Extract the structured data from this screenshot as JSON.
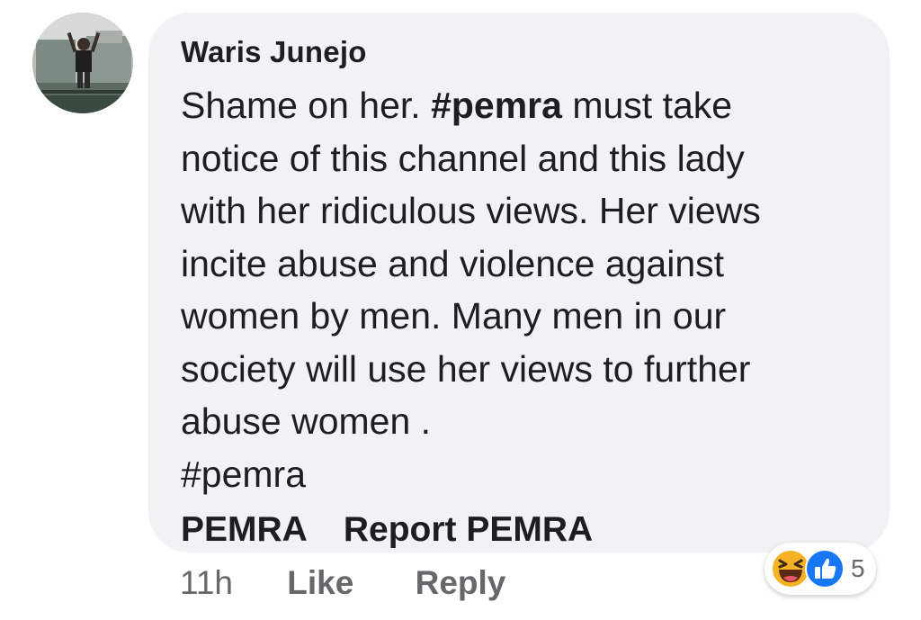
{
  "comment": {
    "author": "Waris Junejo",
    "text_lines": [
      [
        "Shame on her. ",
        "#pemra",
        " must take"
      ],
      "notice of this channel and this lady",
      "with her ridiculous views. Her views",
      "incite abuse and violence against",
      "women by men. Many men in our",
      "society will use her views to further",
      "abuse women ."
    ],
    "hashtag_line": "#pemra",
    "tags": [
      "PEMRA",
      "Report PEMRA"
    ]
  },
  "actions": {
    "time": "11h",
    "like": "Like",
    "reply": "Reply"
  },
  "reactions": {
    "icons": [
      "haha-emoji-icon",
      "like-thumb-icon"
    ],
    "count": "5"
  },
  "colors": {
    "bubble_bg": "#f0f2f5",
    "text": "#1c1e21",
    "muted": "#65676b",
    "like_blue": "#1877f2",
    "haha_yellow": "#f7b125"
  }
}
